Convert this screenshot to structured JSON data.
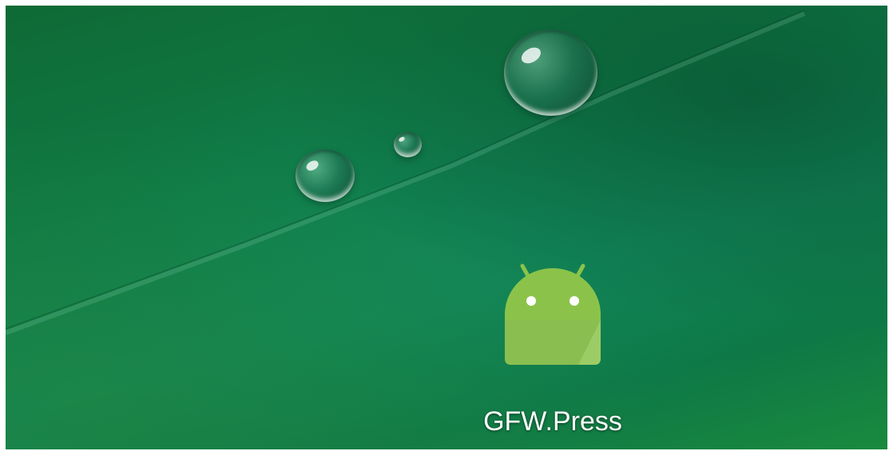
{
  "wallpaper": {
    "icon": "water-drops-leaf-wallpaper",
    "base_color": "#0f7a46"
  },
  "home_screen": {
    "apps": [
      {
        "label": "GFW.Press",
        "icon": "android-robot-icon",
        "icon_color": "#8bc34a"
      }
    ]
  }
}
